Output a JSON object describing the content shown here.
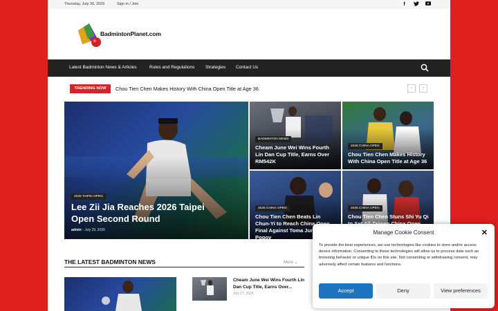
{
  "topbar": {
    "date": "Thursday, July 30, 2026",
    "signin": "Sign in / Join",
    "social": [
      "f",
      "t",
      "yt"
    ]
  },
  "site": {
    "name": "BadmintonPlanet.com"
  },
  "nav": {
    "items": [
      "Latest Badminton News & Articles",
      "Rules and Regulations",
      "Strategies",
      "Contact Us"
    ],
    "search_icon": "search-icon"
  },
  "trending": {
    "label": "TRENDING NOW",
    "headline": "Chou Tien Chen Makes History With China Open Title at Age 36",
    "prev": "‹",
    "next": "›"
  },
  "featured": {
    "main": {
      "category": "2026 TAIPEI OPEN",
      "title": "Lee Zii Jia Reaches 2026 Taipei Open Second Round",
      "author": "admin",
      "date": "July 29, 2026"
    },
    "tiles": [
      {
        "category": "BADMINTON NEWS",
        "title": "Cheam June Wei Wins Fourth Lin Dan Cup Title, Earns Over RM542K"
      },
      {
        "category": "2026 CHINA OPEN",
        "title": "Chou Tien Chen Makes History With China Open Title at Age 36"
      },
      {
        "category": "2026 CHINA OPEN",
        "title": "Chou Tien Chen Beats Lin Chun-Yi to Reach China Open Final Against Toma Junior Popov"
      },
      {
        "category": "2026 CHINA OPEN",
        "title": "Chou Tien Chen Stuns Shi Yu Qi to Set All-Taiwan China Open Final"
      }
    ]
  },
  "latest": {
    "heading": "THE LATEST BADMINTON NEWS",
    "more": "More",
    "side_title": "Cheam June Wei Wins Fourth Lin Dan Cup Title, Earns Over...",
    "side_date": "July 27, 2026"
  },
  "cookie": {
    "title": "Manage Cookie Consent",
    "body": "To provide the best experiences, we use technologies like cookies to store and/or access device information. Consenting to these technologies will allow us to process data such as browsing behavior or unique IDs on this site. Not consenting or withdrawing consent, may adversely affect certain features and functions.",
    "accept": "Accept",
    "deny": "Deny",
    "preferences": "View preferences",
    "close": "✕"
  },
  "colors": {
    "brand_red": "#e0201f",
    "trending_red": "#d8232a",
    "nav_dark": "#222222",
    "accept_blue": "#1e73be"
  }
}
